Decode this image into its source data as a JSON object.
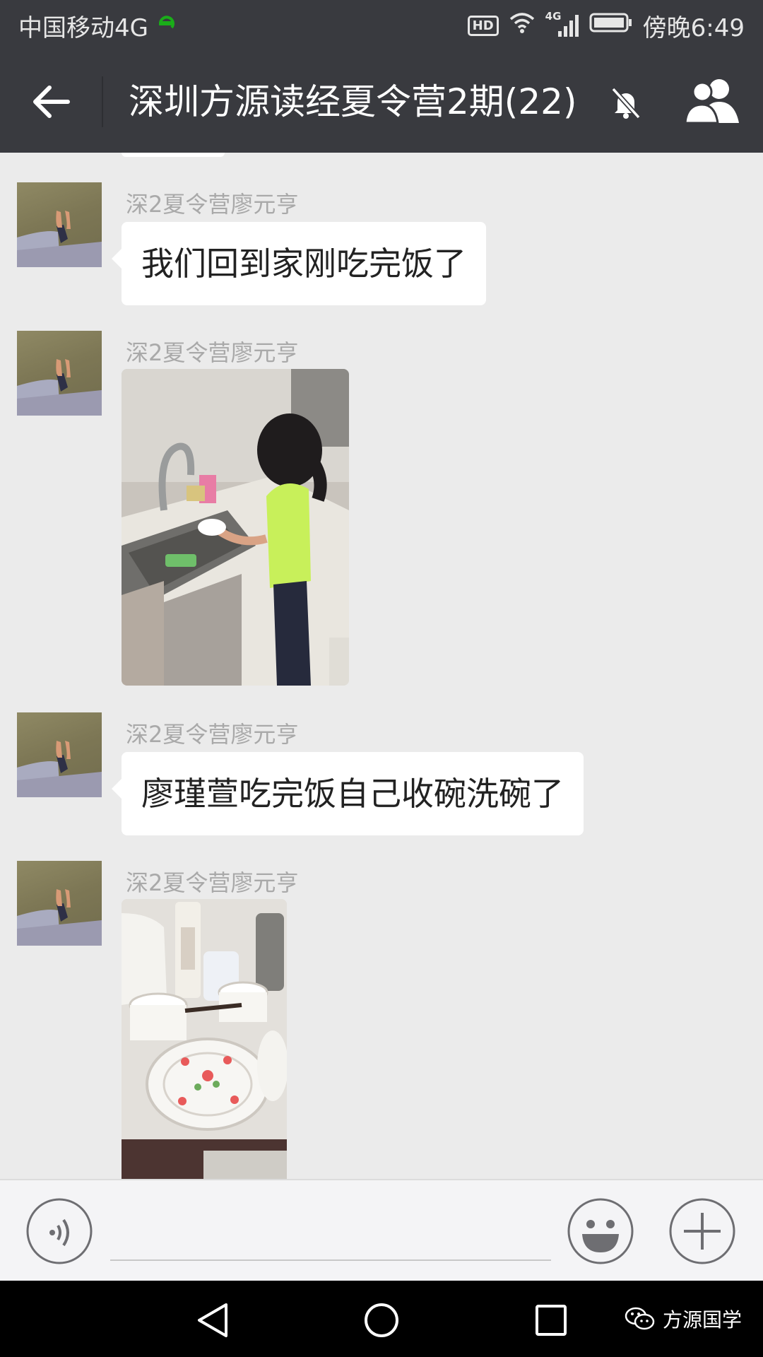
{
  "status_bar": {
    "carrier": "中国移动4G",
    "hd_badge": "HD",
    "network_badge": "4G",
    "time": "傍晚6:49",
    "colors": {
      "background": "#393a3f",
      "e_logo": "#1aad19"
    }
  },
  "header": {
    "title": "深圳方源读经夏令营2期(22)",
    "icons": [
      "back-arrow-icon",
      "mute-bell-icon",
      "group-members-icon"
    ]
  },
  "messages": [
    {
      "sender": "深2夏令营廖元亨",
      "type": "text",
      "text": "我们回到家刚吃完饭了"
    },
    {
      "sender": "深2夏令营廖元亨",
      "type": "image",
      "image_subject": "kitchen-sink-photo"
    },
    {
      "sender": "深2夏令营廖元亨",
      "type": "text",
      "text": "廖瑾萱吃完饭自己收碗洗碗了"
    },
    {
      "sender": "深2夏令营廖元亨",
      "type": "image",
      "image_subject": "dishes-photo"
    }
  ],
  "input_bar": {
    "icons": [
      "voice-icon",
      "emoji-icon",
      "plus-icon"
    ]
  },
  "nav_bar": {
    "icons": [
      "nav-back-icon",
      "nav-home-icon",
      "nav-recent-icon"
    ],
    "watermark": "方源国学"
  }
}
